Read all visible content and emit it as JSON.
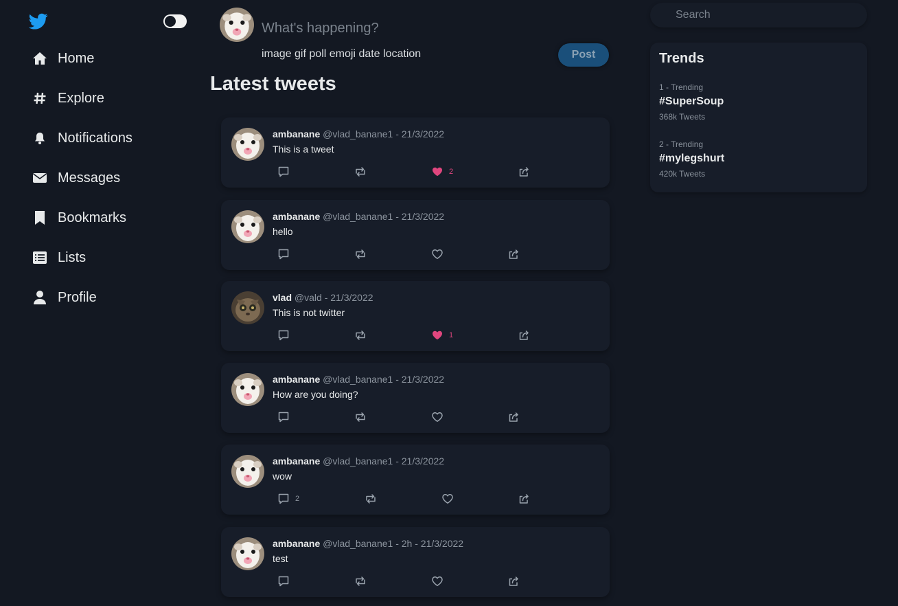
{
  "sidebar": {
    "items": [
      {
        "label": "Home",
        "icon": "home-icon"
      },
      {
        "label": "Explore",
        "icon": "hashtag-icon"
      },
      {
        "label": "Notifications",
        "icon": "bell-icon"
      },
      {
        "label": "Messages",
        "icon": "envelope-icon"
      },
      {
        "label": "Bookmarks",
        "icon": "bookmark-icon"
      },
      {
        "label": "Lists",
        "icon": "list-icon"
      },
      {
        "label": "Profile",
        "icon": "user-icon"
      }
    ]
  },
  "compose": {
    "placeholder": "What's happening?",
    "tools": [
      "image",
      "gif",
      "poll",
      "emoji",
      "date",
      "location"
    ],
    "post_label": "Post"
  },
  "feed": {
    "title": "Latest tweets",
    "tweets": [
      {
        "name": "ambanane",
        "handle": "@vlad_banane1",
        "time": "- 21/3/2022",
        "text": "This is a tweet",
        "likes": "2",
        "comments": ""
      },
      {
        "name": "ambanane",
        "handle": "@vlad_banane1",
        "time": "- 21/3/2022",
        "text": "hello",
        "likes": "",
        "comments": ""
      },
      {
        "name": "vlad",
        "handle": "@vald",
        "time": "- 21/3/2022",
        "text": "This is not twitter",
        "likes": "1",
        "comments": ""
      },
      {
        "name": "ambanane",
        "handle": "@vlad_banane1",
        "time": "- 21/3/2022",
        "text": "How are you doing?",
        "likes": "",
        "comments": ""
      },
      {
        "name": "ambanane",
        "handle": "@vlad_banane1",
        "time": "- 21/3/2022",
        "text": "wow",
        "likes": "",
        "comments": "2"
      },
      {
        "name": "ambanane",
        "handle": "@vlad_banane1",
        "time": "- 2h - 21/3/2022",
        "text": "test",
        "likes": "",
        "comments": ""
      }
    ]
  },
  "search": {
    "placeholder": "Search"
  },
  "trends": {
    "title": "Trends",
    "items": [
      {
        "rank": "1 - Trending",
        "tag": "#SuperSoup",
        "count": "368k Tweets"
      },
      {
        "rank": "2 - Trending",
        "tag": "#mylegshurt",
        "count": "420k Tweets"
      }
    ]
  },
  "colors": {
    "accent": "#1d9bf0",
    "like": "#e0467e",
    "background": "#131822",
    "card": "#171d29"
  }
}
